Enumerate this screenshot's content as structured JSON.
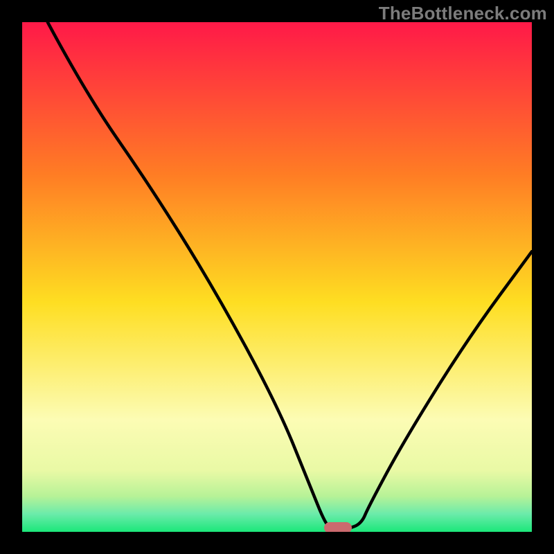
{
  "watermark": "TheBottleneck.com",
  "colors": {
    "top": "#ff1948",
    "mid_upper": "#ff9e16",
    "mid": "#fede22",
    "mid_lower": "#fcfcb4",
    "band1": "#e9f9a5",
    "band2": "#b7f297",
    "bottom": "#1be77a",
    "curve": "#000000",
    "marker": "#cb6a6e",
    "frame": "#000000"
  },
  "chart_data": {
    "type": "line",
    "title": "",
    "xlabel": "",
    "ylabel": "",
    "x_range": [
      0,
      100
    ],
    "y_range": [
      0,
      100
    ],
    "series": [
      {
        "name": "bottleneck-curve",
        "x": [
          5.0,
          12.5,
          25.0,
          37.5,
          50.0,
          56.5,
          59.5,
          61.0,
          63.5,
          66.5,
          68.0,
          75.0,
          87.5,
          100.0
        ],
        "y": [
          100.0,
          86.0,
          68.0,
          48.0,
          25.0,
          9.0,
          1.5,
          0.5,
          0.5,
          1.5,
          5.0,
          18.0,
          38.0,
          55.0
        ]
      }
    ],
    "marker": {
      "x": 62.0,
      "y": 0.8,
      "label": "optimal-range"
    },
    "gradient_stops": [
      {
        "offset": 0.0,
        "color": "#ff1948"
      },
      {
        "offset": 0.3,
        "color": "#ff7d24"
      },
      {
        "offset": 0.55,
        "color": "#fede22"
      },
      {
        "offset": 0.78,
        "color": "#fcfcb4"
      },
      {
        "offset": 0.88,
        "color": "#e9f9a5"
      },
      {
        "offset": 0.93,
        "color": "#b7f297"
      },
      {
        "offset": 0.965,
        "color": "#6bebaa"
      },
      {
        "offset": 1.0,
        "color": "#1be77a"
      }
    ]
  }
}
